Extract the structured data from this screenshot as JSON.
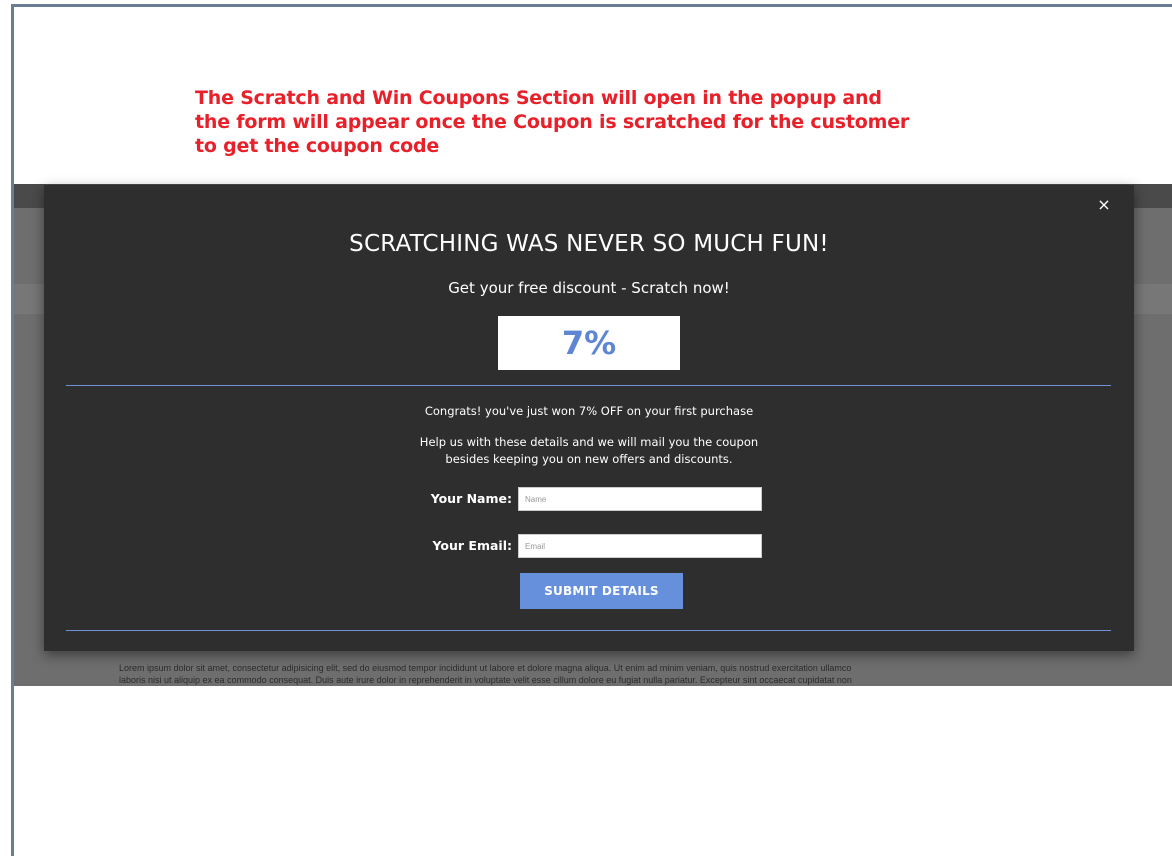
{
  "annotation": {
    "lines": [
      "The Scratch and Win Coupons Section will open in the popup and",
      "the form will appear once the Coupon is scratched for the customer",
      "to get the coupon code"
    ],
    "color": "#e8202a"
  },
  "background_page": {
    "lorem_lines": [
      "Lorem ipsum dolor sit amet, consectetur adipisicing elit, sed do eiusmod tempor incididunt ut labore et dolore magna aliqua. Ut enim ad minim veniam, quis nostrud exercitation ullamco",
      "laboris nisi ut aliquip ex ea commodo consequat. Duis aute irure dolor in reprehenderit in voluptate velit esse cillum dolore eu fugiat nulla pariatur. Excepteur sint occaecat cupidatat non"
    ]
  },
  "popup": {
    "close_label": "×",
    "title": "SCRATCHING WAS NEVER SO MUCH FUN!",
    "subtitle": "Get your free discount - Scratch now!",
    "coupon_value": "7%",
    "congrats": "Congrats! you've just won 7% OFF on your first purchase",
    "help_lines": [
      "Help us with these details and we will mail you the coupon",
      "besides keeping you on new offers and discounts."
    ],
    "name_label": "Your Name:",
    "name_placeholder": "Name",
    "email_label": "Your Email:",
    "email_placeholder": "Email",
    "submit_label": "SUBMIT DETAILS",
    "accent_color": "#6690dc",
    "background_color": "#2e2e2e"
  }
}
